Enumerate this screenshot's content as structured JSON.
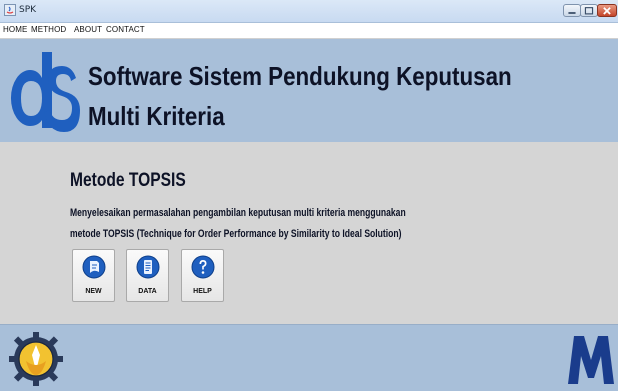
{
  "window": {
    "title": "SPK",
    "icon": "java-app-icon"
  },
  "menu": [
    "HOME",
    "METHOD",
    "ABOUT",
    "CONTACT"
  ],
  "header": {
    "title_line1": "Software Sistem Pendukung Keputusan",
    "title_line2": "Multi Kriteria",
    "logo": "ds-logo"
  },
  "content": {
    "heading": "Metode TOPSIS",
    "description_line1": "Menyelesaikan permasalahan pengambilan keputusan multi kriteria menggunakan",
    "description_line2": "metode TOPSIS (Technique for Order Performance by Similarity to Ideal Solution)"
  },
  "buttons": {
    "new": "NEW",
    "data": "DATA",
    "help": "HELP"
  },
  "footer": {
    "left_logo": "university-emblem",
    "right_logo": "m-brand-logo"
  },
  "colors": {
    "header_bg": "#a8bfd9",
    "content_bg": "#d5d5d5",
    "accent_blue": "#1f5fbf",
    "title_text": "#0d1226"
  }
}
